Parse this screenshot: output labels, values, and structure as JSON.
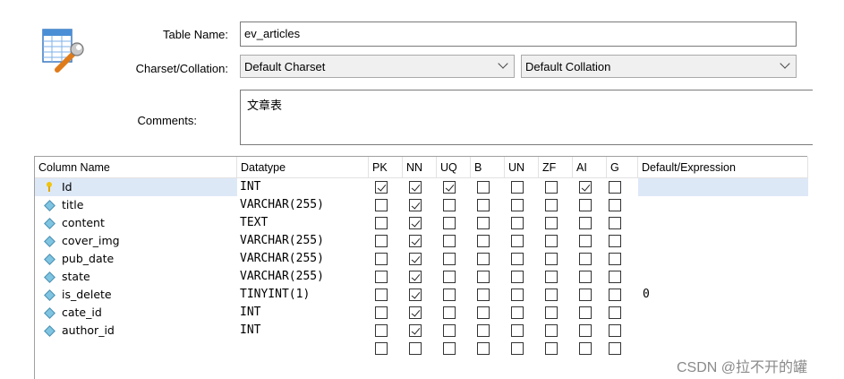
{
  "form": {
    "table_name_label": "Table Name:",
    "table_name_value": "ev_articles",
    "charset_label": "Charset/Collation:",
    "charset_value": "Default Charset",
    "collation_value": "Default Collation",
    "comments_label": "Comments:",
    "comments_value": "文章表"
  },
  "grid": {
    "headers": [
      "Column Name",
      "Datatype",
      "PK",
      "NN",
      "UQ",
      "B",
      "UN",
      "ZF",
      "AI",
      "G",
      "Default/Expression"
    ],
    "rows": [
      {
        "name": "Id",
        "datatype": "INT",
        "pk": true,
        "nn": true,
        "uq": true,
        "b": false,
        "un": false,
        "zf": false,
        "ai": true,
        "g": false,
        "default": "",
        "icon": "primary-key-icon"
      },
      {
        "name": "title",
        "datatype": "VARCHAR(255)",
        "pk": false,
        "nn": true,
        "uq": false,
        "b": false,
        "un": false,
        "zf": false,
        "ai": false,
        "g": false,
        "default": "",
        "icon": "column-icon"
      },
      {
        "name": "content",
        "datatype": "TEXT",
        "pk": false,
        "nn": true,
        "uq": false,
        "b": false,
        "un": false,
        "zf": false,
        "ai": false,
        "g": false,
        "default": "",
        "icon": "column-icon"
      },
      {
        "name": "cover_img",
        "datatype": "VARCHAR(255)",
        "pk": false,
        "nn": true,
        "uq": false,
        "b": false,
        "un": false,
        "zf": false,
        "ai": false,
        "g": false,
        "default": "",
        "icon": "column-icon"
      },
      {
        "name": "pub_date",
        "datatype": "VARCHAR(255)",
        "pk": false,
        "nn": true,
        "uq": false,
        "b": false,
        "un": false,
        "zf": false,
        "ai": false,
        "g": false,
        "default": "",
        "icon": "column-icon"
      },
      {
        "name": "state",
        "datatype": "VARCHAR(255)",
        "pk": false,
        "nn": true,
        "uq": false,
        "b": false,
        "un": false,
        "zf": false,
        "ai": false,
        "g": false,
        "default": "",
        "icon": "column-icon"
      },
      {
        "name": "is_delete",
        "datatype": "TINYINT(1)",
        "pk": false,
        "nn": true,
        "uq": false,
        "b": false,
        "un": false,
        "zf": false,
        "ai": false,
        "g": false,
        "default": "0",
        "icon": "column-icon"
      },
      {
        "name": "cate_id",
        "datatype": "INT",
        "pk": false,
        "nn": true,
        "uq": false,
        "b": false,
        "un": false,
        "zf": false,
        "ai": false,
        "g": false,
        "default": "",
        "icon": "column-icon"
      },
      {
        "name": "author_id",
        "datatype": "INT",
        "pk": false,
        "nn": true,
        "uq": false,
        "b": false,
        "un": false,
        "zf": false,
        "ai": false,
        "g": false,
        "default": "",
        "icon": "column-icon"
      },
      {
        "name": "",
        "datatype": "",
        "pk": false,
        "nn": false,
        "uq": false,
        "b": false,
        "un": false,
        "zf": false,
        "ai": false,
        "g": false,
        "default": "",
        "icon": ""
      }
    ]
  },
  "watermark": "CSDN @拉不开的罐"
}
